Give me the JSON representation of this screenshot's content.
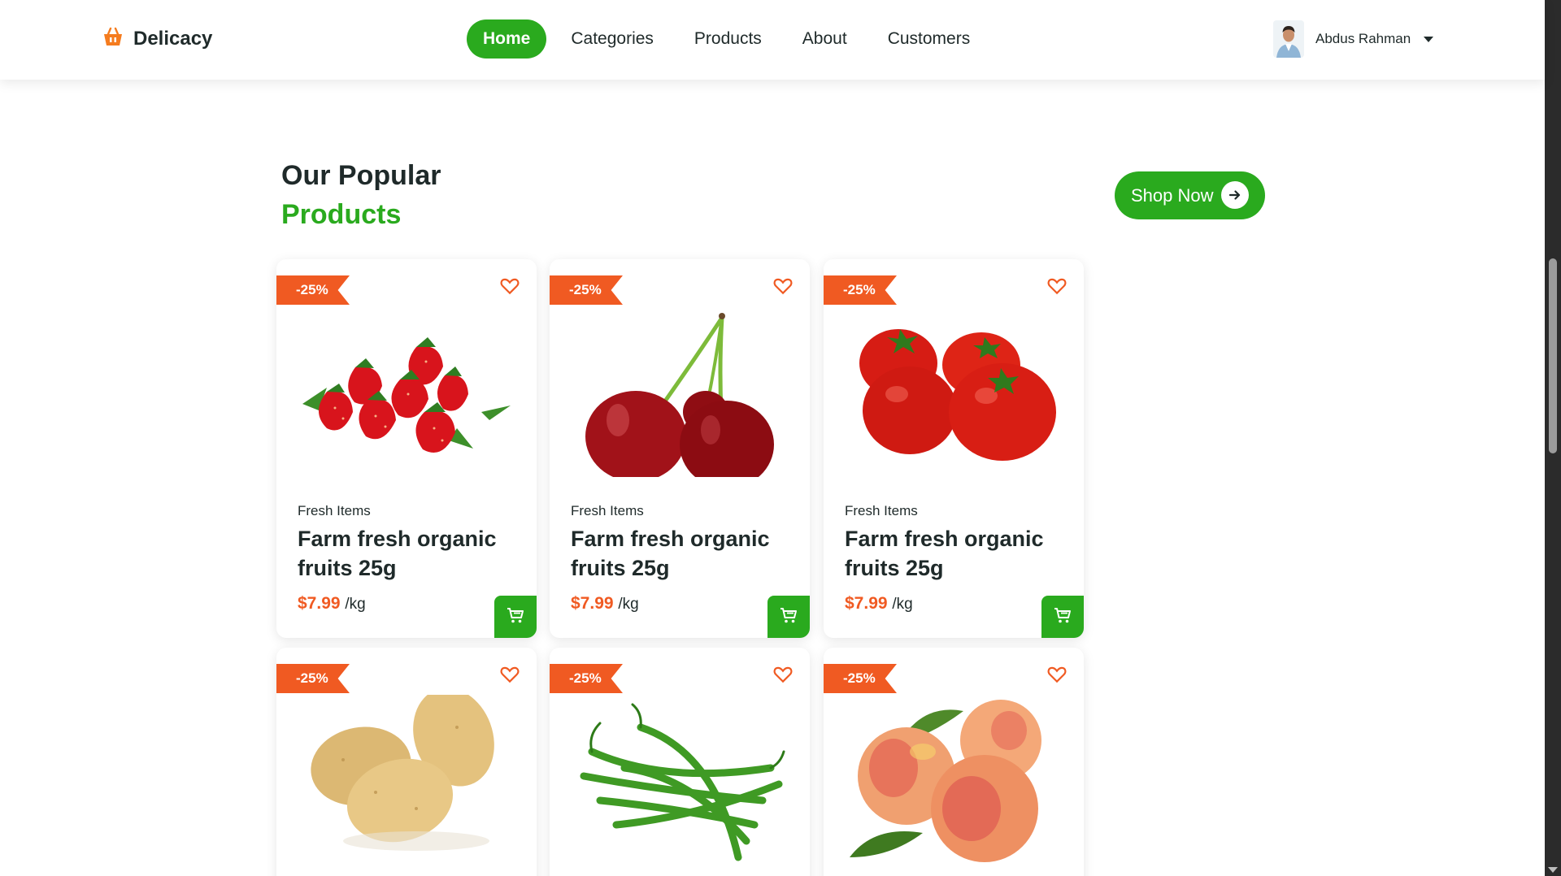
{
  "brand": {
    "name": "Delicacy",
    "icon": "basket-icon",
    "accent": "#f57c1f"
  },
  "nav": {
    "items": [
      {
        "label": "Home",
        "active": true
      },
      {
        "label": "Categories",
        "active": false
      },
      {
        "label": "Products",
        "active": false
      },
      {
        "label": "About",
        "active": false
      },
      {
        "label": "Customers",
        "active": false
      }
    ]
  },
  "user": {
    "name": "Abdus Rahman",
    "icon": "chevron-down-icon"
  },
  "section": {
    "title_line1": "Our Popular",
    "title_line2": "Products",
    "shop_button": "Shop Now"
  },
  "colors": {
    "primary": "#2aaa1e",
    "accent": "#f05a22",
    "text": "#1f2a2a"
  },
  "products": [
    {
      "badge": "-25%",
      "category": "Fresh Items",
      "name": "Farm fresh organic fruits 25g",
      "price": "$7.99",
      "unit": "/kg",
      "image": "strawberries"
    },
    {
      "badge": "-25%",
      "category": "Fresh Items",
      "name": "Farm fresh organic fruits 25g",
      "price": "$7.99",
      "unit": "/kg",
      "image": "cherries"
    },
    {
      "badge": "-25%",
      "category": "Fresh Items",
      "name": "Farm fresh organic fruits 25g",
      "price": "$7.99",
      "unit": "/kg",
      "image": "tomatoes"
    },
    {
      "badge": "-25%",
      "image": "potatoes"
    },
    {
      "badge": "-25%",
      "image": "green-chillies"
    },
    {
      "badge": "-25%",
      "image": "peaches"
    }
  ]
}
